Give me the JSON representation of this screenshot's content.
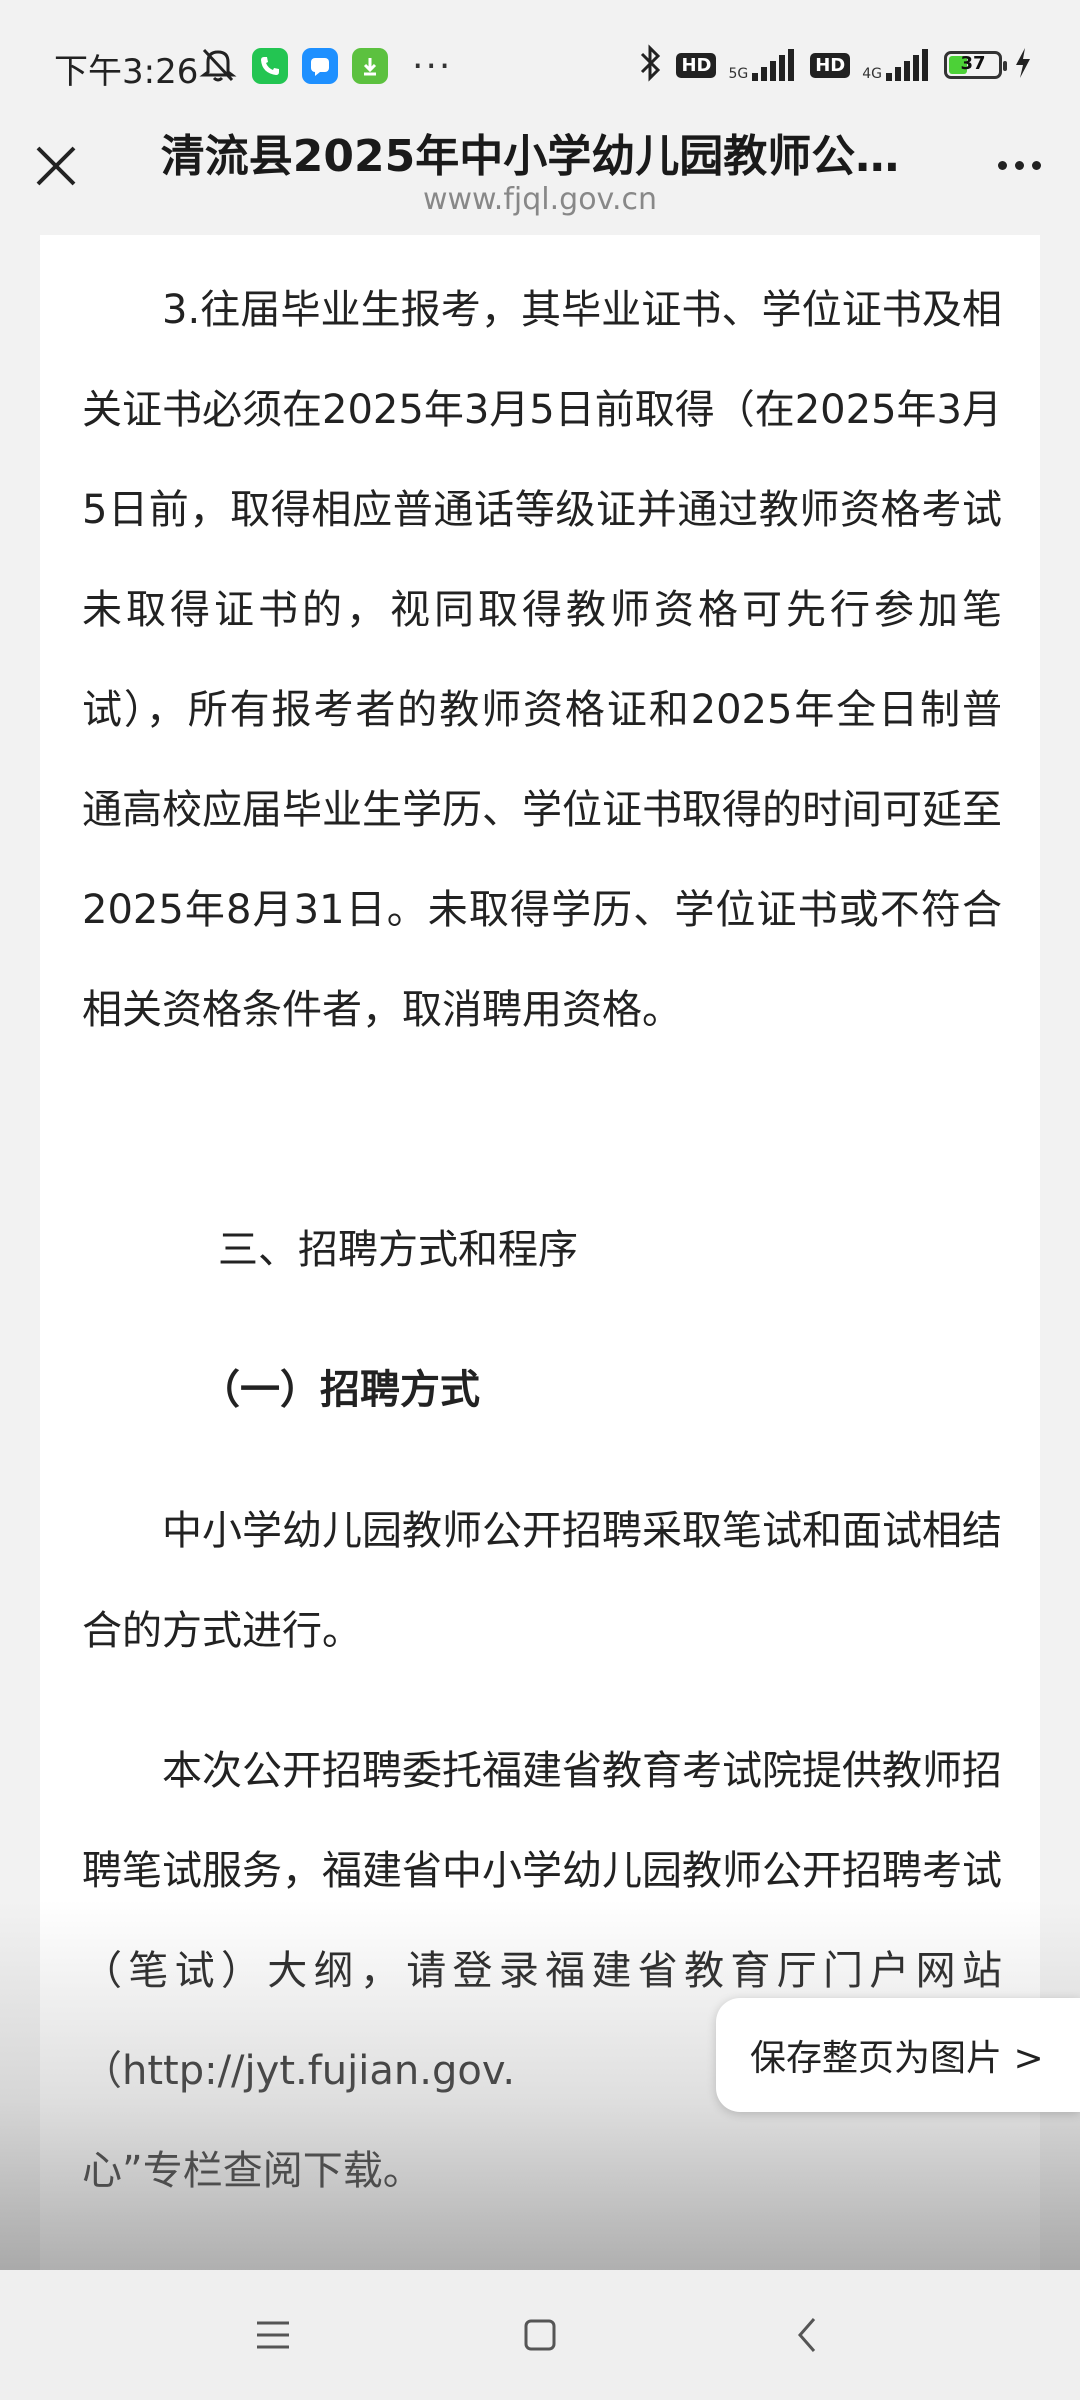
{
  "status_bar": {
    "time": "下午3:26",
    "network_5g": "5G",
    "network_4g": "4G",
    "hd_label": "HD",
    "battery_level": "37",
    "battery_fraction": 0.37,
    "colors": {
      "phone_app": "#23c552",
      "message_app": "#1e90ff",
      "download_app": "#5cc13f"
    },
    "icons": [
      "mute-bell-icon",
      "phone-app-icon",
      "message-app-icon",
      "download-app-icon",
      "more-icon",
      "bluetooth-icon",
      "signal-icon",
      "battery-icon",
      "charging-icon"
    ]
  },
  "title_bar": {
    "title": "清流县2025年中小学幼儿园教师公…",
    "url": "www.fjql.gov.cn"
  },
  "article": {
    "para1": "3.往届毕业生报考，其毕业证书、学位证书及相关证书必须在2025年3月5日前取得（在2025年3月5日前，取得相应普通话等级证并通过教师资格考试未取得证书的，视同取得教师资格可先行参加笔试），所有报考者的教师资格证和2025年全日制普通高校应届毕业生学历、学位证书取得的时间可延至2025年8月31日。未取得学历、学位证书或不符合相关资格条件者，取消聘用资格。",
    "section_heading": "三、招聘方式和程序",
    "sub_heading": "（一）招聘方式",
    "para2": "中小学幼儿园教师公开招聘采取笔试和面试相结合的方式进行。",
    "para3": "本次公开招聘委托福建省教育考试院提供教师招聘笔试服务，福建省中小学幼儿园教师公开招聘考试（笔试）大纲，请登录福建省教育厅门户网站（http://jyt.fujian.gov.",
    "para3_tail": "心”专栏查阅下载。"
  },
  "save_page_button": "保存整页为图片 >"
}
